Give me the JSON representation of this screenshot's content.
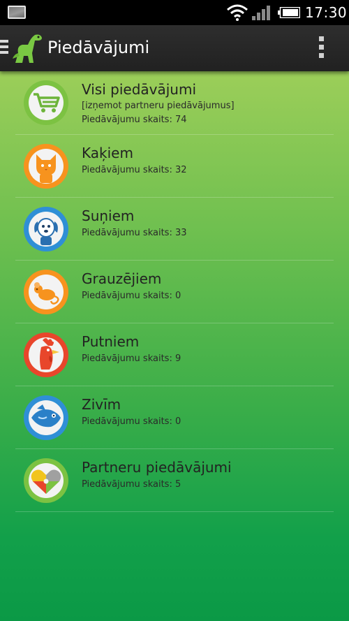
{
  "status_bar": {
    "time": "17:30",
    "icons": [
      "gallery-icon",
      "wifi-icon",
      "signal-icon",
      "battery-icon"
    ]
  },
  "action_bar": {
    "title": "Piedāvājumi",
    "icons": [
      "drawer-icon",
      "dinosaur-logo-icon",
      "overflow-menu-icon"
    ]
  },
  "categories": [
    {
      "title": "Visi piedāvājumi",
      "note": "[izņemot partneru piedāvājumus]",
      "count_text": "Piedāvājumu skaits: 74",
      "icon": "shopping-cart-icon",
      "ring_color": "#7cc242"
    },
    {
      "title": "Kaķiem",
      "count_text": "Piedāvājumu skaits: 32",
      "icon": "cat-icon",
      "ring_color": "#f7931e"
    },
    {
      "title": "Suņiem",
      "count_text": "Piedāvājumu skaits: 33",
      "icon": "dog-icon",
      "ring_color": "#2f8fd6"
    },
    {
      "title": "Grauzējiem",
      "count_text": "Piedāvājumu skaits: 0",
      "icon": "mouse-icon",
      "ring_color": "#f7931e"
    },
    {
      "title": "Putniem",
      "count_text": "Piedāvājumu skaits: 9",
      "icon": "rooster-icon",
      "ring_color": "#e8462b"
    },
    {
      "title": "Zivīm",
      "count_text": "Piedāvājumu skaits: 0",
      "icon": "fish-icon",
      "ring_color": "#2f8fd6"
    },
    {
      "title": "Partneru piedāvājumi",
      "count_text": "Piedāvājumu skaits: 5",
      "icon": "puzzle-heart-icon",
      "ring_color": "#7cc242"
    }
  ]
}
